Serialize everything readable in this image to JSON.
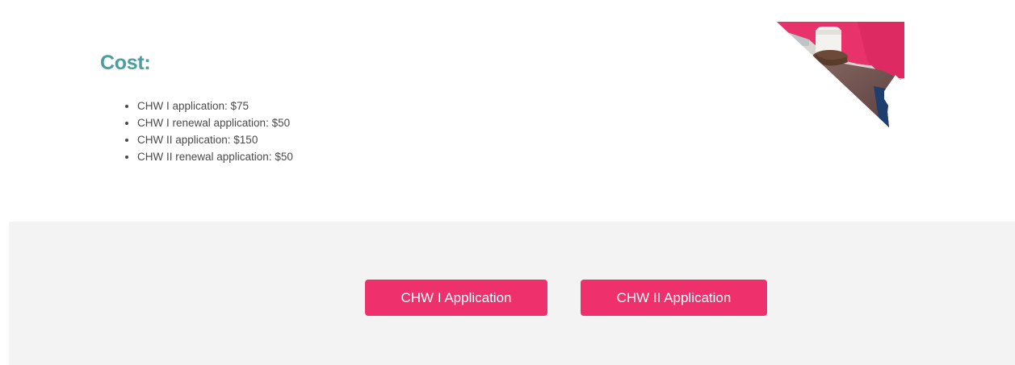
{
  "cost_section": {
    "title": "Cost:",
    "items": [
      "CHW I application: $75",
      "CHW I renewal application: $50",
      "CHW II application: $150",
      "CHW II renewal application: $50"
    ]
  },
  "cta": {
    "chw1_label": "CHW I Application",
    "chw2_label": "CHW II Application"
  },
  "colors": {
    "title": "#4a9ea0",
    "button": "#ee306c",
    "band": "#f3f3f3",
    "text": "#4a4a4a"
  }
}
